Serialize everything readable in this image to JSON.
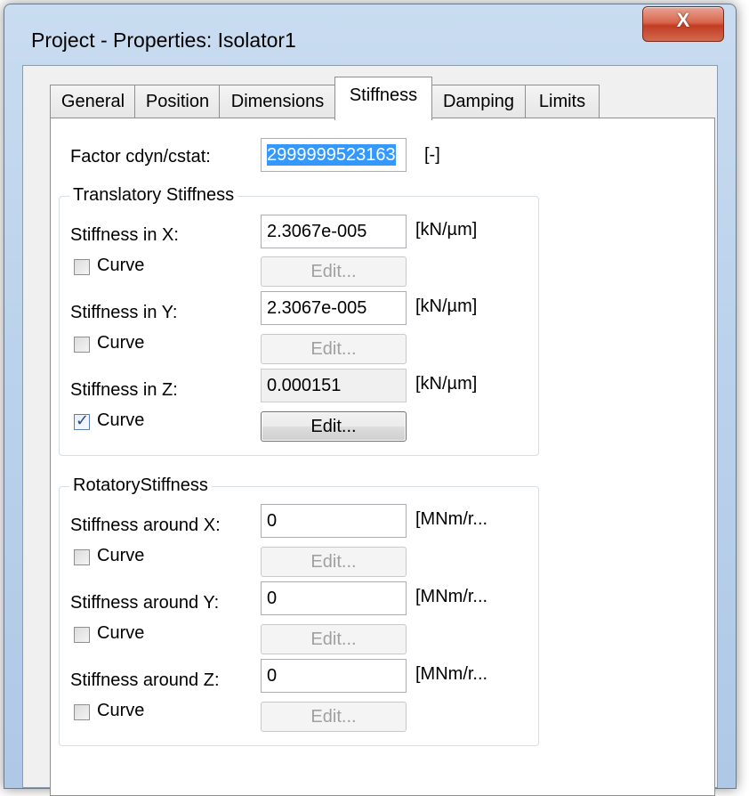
{
  "window": {
    "title": "Project - Properties: Isolator1",
    "close_glyph": "X"
  },
  "tabs": [
    {
      "label": "General",
      "active": false
    },
    {
      "label": "Position",
      "active": false
    },
    {
      "label": "Dimensions",
      "active": false
    },
    {
      "label": "Stiffness",
      "active": true
    },
    {
      "label": "Damping",
      "active": false
    },
    {
      "label": "Limits",
      "active": false
    }
  ],
  "factor": {
    "label": "Factor cdyn/cstat:",
    "value": "2999999523163",
    "unit": "[-]"
  },
  "translatory": {
    "legend": "Translatory Stiffness",
    "rows": [
      {
        "label": "Stiffness in X:",
        "value": "2.3067e-005",
        "unit": "[kN/µm]",
        "curve_label": "Curve",
        "curve_checked": false,
        "edit_label": "Edit...",
        "edit_enabled": false
      },
      {
        "label": "Stiffness in Y:",
        "value": "2.3067e-005",
        "unit": "[kN/µm]",
        "curve_label": "Curve",
        "curve_checked": false,
        "edit_label": "Edit...",
        "edit_enabled": false
      },
      {
        "label": "Stiffness in Z:",
        "value": "0.000151",
        "unit": "[kN/µm]",
        "curve_label": "Curve",
        "curve_checked": true,
        "edit_label": "Edit...",
        "edit_enabled": true
      }
    ]
  },
  "rotatory": {
    "legend": "RotatoryStiffness",
    "rows": [
      {
        "label": "Stiffness around X:",
        "value": "0",
        "unit": "[MNm/r...",
        "curve_label": "Curve",
        "curve_checked": false,
        "edit_label": "Edit...",
        "edit_enabled": false
      },
      {
        "label": "Stiffness around Y:",
        "value": "0",
        "unit": "[MNm/r...",
        "curve_label": "Curve",
        "curve_checked": false,
        "edit_label": "Edit...",
        "edit_enabled": false
      },
      {
        "label": "Stiffness around Z:",
        "value": "0",
        "unit": "[MNm/r...",
        "curve_label": "Curve",
        "curve_checked": false,
        "edit_label": "Edit...",
        "edit_enabled": false
      }
    ]
  },
  "checkmark_glyph": "✓",
  "colors": {
    "selection": "#3399ff",
    "close_button": "#c13c22",
    "frame": "#bcd3ec"
  }
}
